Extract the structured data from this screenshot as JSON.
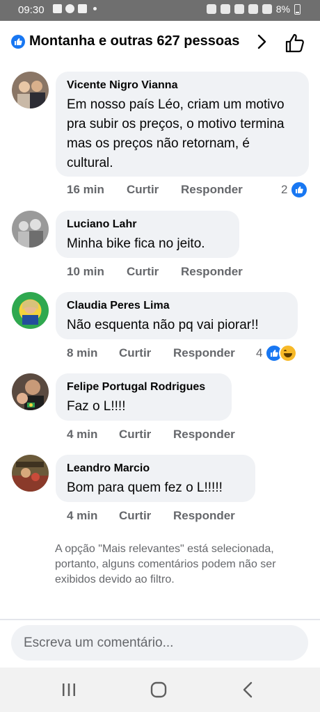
{
  "status_bar": {
    "time": "09:30",
    "battery": "8%",
    "network": "Voz WiFi LTE"
  },
  "header": {
    "title": "Montanha e outras 627 pessoas"
  },
  "comments": [
    {
      "author": "Vicente Nigro Vianna",
      "text": "Em nosso país Léo, criam um motivo pra subir os preços, o motivo termina mas os preços não retornam, é cultural.",
      "time": "16 min",
      "like_label": "Curtir",
      "reply_label": "Responder",
      "reaction_count": "2",
      "reactions": [
        "like"
      ]
    },
    {
      "author": "Luciano Lahr",
      "text": "Minha bike fica no jeito.",
      "time": "10 min",
      "like_label": "Curtir",
      "reply_label": "Responder"
    },
    {
      "author": "Claudia Peres Lima",
      "text": "Não esquenta não pq vai piorar!!",
      "time": "8 min",
      "like_label": "Curtir",
      "reply_label": "Responder",
      "reaction_count": "4",
      "reactions": [
        "like",
        "haha"
      ]
    },
    {
      "author": "Felipe Portugal Rodrigues",
      "text": "Faz o L!!!!",
      "time": "4 min",
      "like_label": "Curtir",
      "reply_label": "Responder"
    },
    {
      "author": "Leandro Marcio",
      "text": "Bom para quem fez o L!!!!!",
      "time": "4 min",
      "like_label": "Curtir",
      "reply_label": "Responder"
    }
  ],
  "filter_note": "A opção \"Mais relevantes\" está selecionada, portanto, alguns comentários podem não ser exibidos devido ao filtro.",
  "composer": {
    "placeholder": "Escreva um comentário..."
  },
  "colors": {
    "accent": "#1877f2",
    "bubble": "#f0f2f5",
    "secondary_text": "#65676b"
  }
}
